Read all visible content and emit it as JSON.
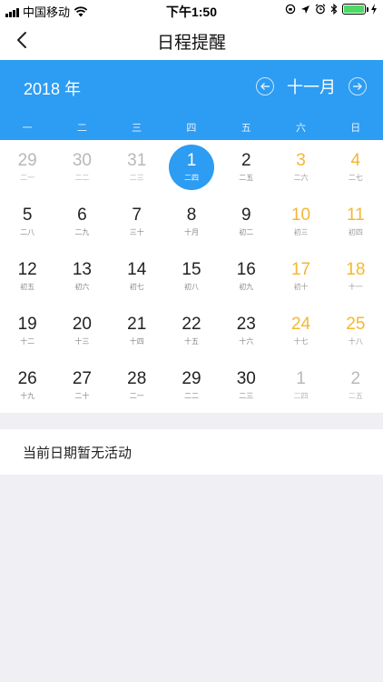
{
  "status": {
    "carrier": "中国移动",
    "time": "下午1:50"
  },
  "nav": {
    "title": "日程提醒"
  },
  "calendar": {
    "year": "2018 年",
    "month": "十一月",
    "weekdays": [
      "一",
      "二",
      "三",
      "四",
      "五",
      "六",
      "日"
    ],
    "days": [
      {
        "d": "29",
        "l": "二一",
        "t": "other"
      },
      {
        "d": "30",
        "l": "二二",
        "t": "other"
      },
      {
        "d": "31",
        "l": "二三",
        "t": "other"
      },
      {
        "d": "1",
        "l": "二四",
        "t": "selected"
      },
      {
        "d": "2",
        "l": "二五",
        "t": "normal"
      },
      {
        "d": "3",
        "l": "二六",
        "t": "weekend"
      },
      {
        "d": "4",
        "l": "二七",
        "t": "weekend"
      },
      {
        "d": "5",
        "l": "二八",
        "t": "normal"
      },
      {
        "d": "6",
        "l": "二九",
        "t": "normal"
      },
      {
        "d": "7",
        "l": "三十",
        "t": "normal"
      },
      {
        "d": "8",
        "l": "十月",
        "t": "normal"
      },
      {
        "d": "9",
        "l": "初二",
        "t": "normal"
      },
      {
        "d": "10",
        "l": "初三",
        "t": "weekend"
      },
      {
        "d": "11",
        "l": "初四",
        "t": "weekend"
      },
      {
        "d": "12",
        "l": "初五",
        "t": "normal"
      },
      {
        "d": "13",
        "l": "初六",
        "t": "normal"
      },
      {
        "d": "14",
        "l": "初七",
        "t": "normal"
      },
      {
        "d": "15",
        "l": "初八",
        "t": "normal"
      },
      {
        "d": "16",
        "l": "初九",
        "t": "normal"
      },
      {
        "d": "17",
        "l": "初十",
        "t": "weekend"
      },
      {
        "d": "18",
        "l": "十一",
        "t": "weekend"
      },
      {
        "d": "19",
        "l": "十二",
        "t": "normal"
      },
      {
        "d": "20",
        "l": "十三",
        "t": "normal"
      },
      {
        "d": "21",
        "l": "十四",
        "t": "normal"
      },
      {
        "d": "22",
        "l": "十五",
        "t": "normal"
      },
      {
        "d": "23",
        "l": "十六",
        "t": "normal"
      },
      {
        "d": "24",
        "l": "十七",
        "t": "weekend"
      },
      {
        "d": "25",
        "l": "十八",
        "t": "weekend"
      },
      {
        "d": "26",
        "l": "十九",
        "t": "normal"
      },
      {
        "d": "27",
        "l": "二十",
        "t": "normal"
      },
      {
        "d": "28",
        "l": "二一",
        "t": "normal"
      },
      {
        "d": "29",
        "l": "二二",
        "t": "normal"
      },
      {
        "d": "30",
        "l": "二三",
        "t": "normal"
      },
      {
        "d": "1",
        "l": "二四",
        "t": "other"
      },
      {
        "d": "2",
        "l": "二五",
        "t": "other"
      }
    ]
  },
  "empty": {
    "message": "当前日期暂无活动"
  },
  "colors": {
    "accent": "#2d9cf3",
    "weekend": "#f5b731"
  },
  "icons": [
    "signal-icon",
    "wifi-icon",
    "rotation-lock-icon",
    "location-icon",
    "alarm-icon",
    "bluetooth-icon",
    "battery-icon",
    "charging-icon",
    "back-chevron-icon",
    "arrow-left-icon",
    "arrow-right-icon"
  ]
}
